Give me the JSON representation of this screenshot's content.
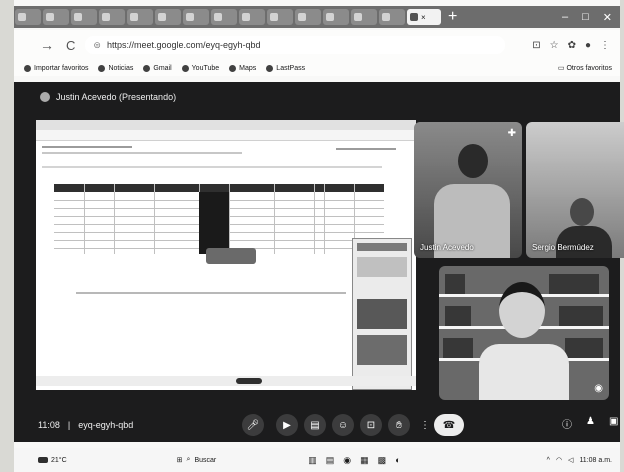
{
  "browser": {
    "tab_count": 15,
    "new_tab_symbol": "+",
    "window_controls": [
      "–",
      "□",
      "✕"
    ],
    "url": "https://meet.google.com/eyq-egyh-qbd",
    "bookmarks": [
      "Importar favoritos",
      "Noticias",
      "Gmail",
      "YouTube",
      "Maps",
      "LastPass"
    ],
    "other_bookmarks": "Otros favoritos"
  },
  "meet": {
    "presenter_label": "Justin Acevedo (Presentando)",
    "participants": [
      {
        "name": "Justin Acevedo"
      },
      {
        "name": "Sergio Bermúdez"
      },
      {
        "name": ""
      }
    ],
    "time": "11:08",
    "meeting_code": "eyq-egyh-qbd"
  },
  "taskbar": {
    "weather": "21°C",
    "search": "Buscar",
    "clock": "11:08 a.m."
  },
  "colors": {
    "meet_bg": "#202124",
    "control_btn": "#3c4043"
  }
}
